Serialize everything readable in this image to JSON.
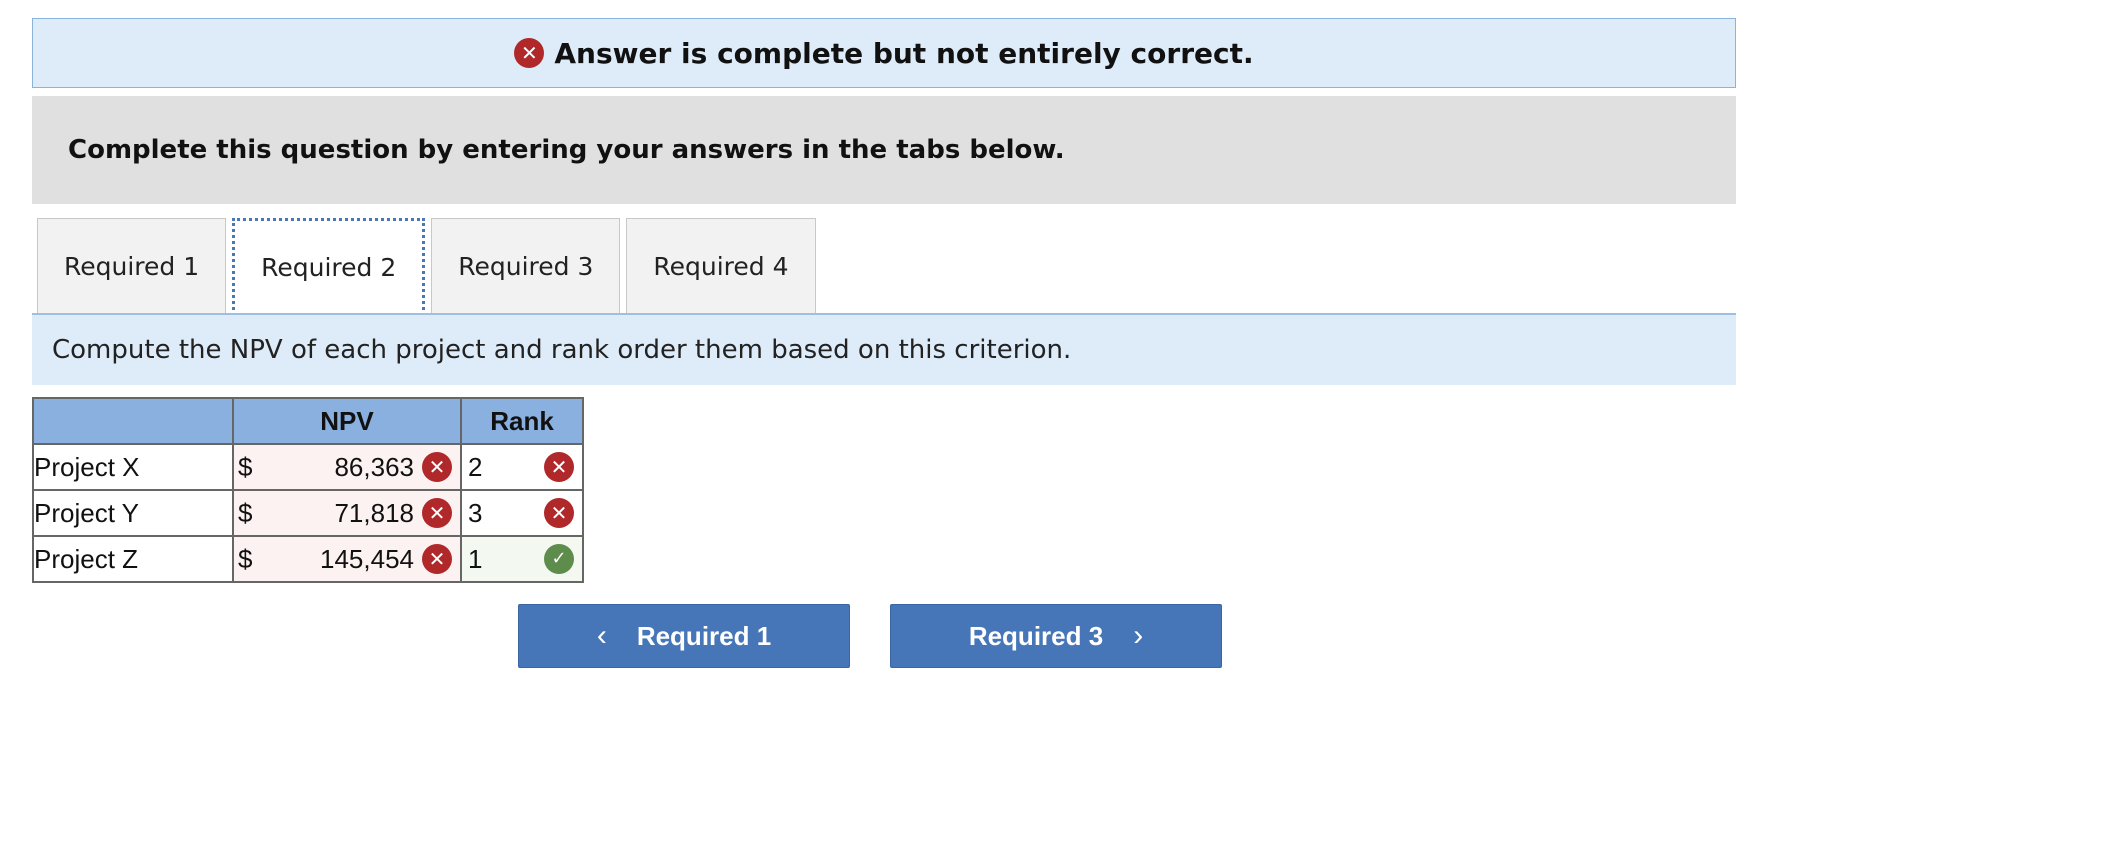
{
  "banner": {
    "icon": "error-circle-icon",
    "text": "Answer is complete but not entirely correct."
  },
  "instruction": "Complete this question by entering your answers in the tabs below.",
  "tabs": [
    {
      "label": "Required 1",
      "active": false
    },
    {
      "label": "Required 2",
      "active": true
    },
    {
      "label": "Required 3",
      "active": false
    },
    {
      "label": "Required 4",
      "active": false
    }
  ],
  "prompt": "Compute the NPV of each project and rank order them based on this criterion.",
  "table": {
    "headers": {
      "name": "",
      "npv": "NPV",
      "rank": "Rank"
    },
    "currency": "$",
    "rows": [
      {
        "name": "Project X",
        "npv": "86,363",
        "npv_status": "incorrect",
        "rank": "2",
        "rank_status": "incorrect"
      },
      {
        "name": "Project Y",
        "npv": "71,818",
        "npv_status": "incorrect",
        "rank": "3",
        "rank_status": "incorrect"
      },
      {
        "name": "Project Z",
        "npv": "145,454",
        "npv_status": "incorrect",
        "rank": "1",
        "rank_status": "correct"
      }
    ]
  },
  "nav": {
    "prev_label": "Required 1",
    "next_label": "Required 3"
  },
  "colors": {
    "error": "#b0282a",
    "correct": "#5e8c4c",
    "button": "#4676b8",
    "header": "#8ab0e0"
  }
}
